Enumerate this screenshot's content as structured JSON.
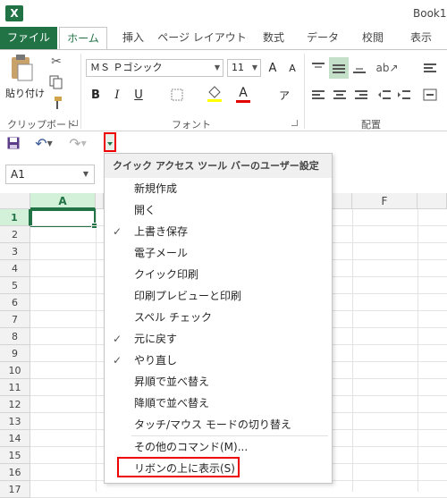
{
  "app": {
    "logo": "X",
    "title": "Book1"
  },
  "tabs": [
    "ファイル",
    "ホーム",
    "挿入",
    "ページ レイアウト",
    "数式",
    "データ",
    "校閲",
    "表示"
  ],
  "ribbon": {
    "paste_label": "貼り付け",
    "font_name": "ＭＳ Ｐゴシック",
    "font_size": "11",
    "bold": "B",
    "italic": "I",
    "underline": "U",
    "font_color_glyph": "A",
    "grow_font": "A",
    "shrink_font": "A",
    "groups": {
      "clipboard": "クリップボード",
      "font": "フォント",
      "alignment": "配置"
    }
  },
  "namebox": {
    "value": "A1"
  },
  "columns": [
    "A",
    "F"
  ],
  "rows": [
    "1",
    "2",
    "3",
    "4",
    "5",
    "6",
    "7",
    "8",
    "9",
    "10",
    "11",
    "12",
    "13",
    "14",
    "15",
    "16",
    "17"
  ],
  "menu": {
    "title": "クイック アクセス ツール バーのユーザー設定",
    "items": [
      {
        "label": "新規作成",
        "checked": ""
      },
      {
        "label": "開く",
        "checked": ""
      },
      {
        "label": "上書き保存",
        "checked": "✓"
      },
      {
        "label": "電子メール",
        "checked": ""
      },
      {
        "label": "クイック印刷",
        "checked": ""
      },
      {
        "label": "印刷プレビューと印刷",
        "checked": ""
      },
      {
        "label": "スペル チェック",
        "checked": ""
      },
      {
        "label": "元に戻す",
        "checked": "✓"
      },
      {
        "label": "やり直し",
        "checked": "✓"
      },
      {
        "label": "昇順で並べ替え",
        "checked": ""
      },
      {
        "label": "降順で並べ替え",
        "checked": ""
      },
      {
        "label": "タッチ/マウス モードの切り替え",
        "checked": ""
      }
    ],
    "more_commands": "その他のコマンド(M)...",
    "show_below": "リボンの上に表示(S)"
  },
  "colors": {
    "accent": "#217346",
    "highlight": "#e00000"
  }
}
